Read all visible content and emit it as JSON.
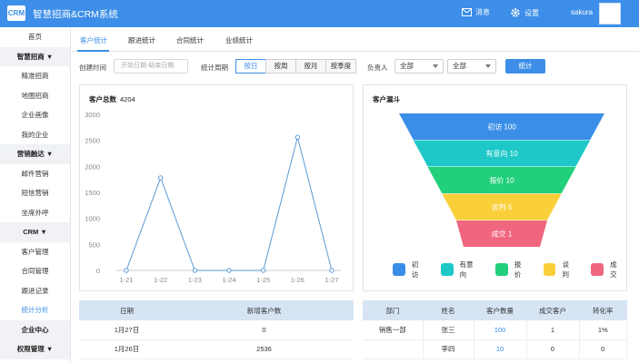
{
  "app": {
    "logo": "CRM",
    "title": "智慧招商&CRM系统"
  },
  "header": {
    "messages": "消息",
    "settings": "设置",
    "user": "sakura"
  },
  "sidebar": {
    "items": [
      {
        "label": "首页",
        "type": "item"
      },
      {
        "label": "智慧招商 ▼",
        "type": "group"
      },
      {
        "label": "精准招商",
        "type": "item"
      },
      {
        "label": "地图招商",
        "type": "item"
      },
      {
        "label": "企业画像",
        "type": "item"
      },
      {
        "label": "我的企业",
        "type": "item"
      },
      {
        "label": "营销触达 ▼",
        "type": "group"
      },
      {
        "label": "邮件营销",
        "type": "item"
      },
      {
        "label": "短信营销",
        "type": "item"
      },
      {
        "label": "坐席外呼",
        "type": "item"
      },
      {
        "label": "CRM ▼",
        "type": "group"
      },
      {
        "label": "客户管理",
        "type": "item"
      },
      {
        "label": "合同管理",
        "type": "item"
      },
      {
        "label": "跟进记录",
        "type": "item"
      },
      {
        "label": "统计分析",
        "type": "active"
      },
      {
        "label": "企业中心",
        "type": "group"
      },
      {
        "label": "权限管理 ▼",
        "type": "group"
      }
    ]
  },
  "tabs": [
    "客户统计",
    "跟进统计",
    "合同统计",
    "业绩统计"
  ],
  "filters": {
    "created_label": "创建时间",
    "date_placeholder": "开始日期-结束日期",
    "period_label": "统计周期",
    "periods": [
      "按日",
      "按周",
      "按月",
      "按季度"
    ],
    "owner_label": "负责人",
    "select1": "全部",
    "select2": "全部",
    "button": "统计"
  },
  "line_card": {
    "title": "客户总数",
    "total": "4204"
  },
  "chart_data": [
    {
      "type": "line",
      "title": "客户总数",
      "x": [
        "1-21",
        "1-22",
        "1-23",
        "1-24",
        "1-25",
        "1-26",
        "1-27"
      ],
      "values": [
        0,
        1780,
        0,
        0,
        0,
        2560,
        0
      ],
      "ylim": [
        0,
        3000
      ],
      "yticks": [
        0,
        500,
        1000,
        1500,
        2000,
        2500,
        3000
      ],
      "grid": false,
      "color": "#5b9bd5"
    },
    {
      "type": "funnel",
      "title": "客户漏斗",
      "categories": [
        "初访",
        "有意向",
        "报价",
        "谈判",
        "成交"
      ],
      "values": [
        100,
        10,
        10,
        5,
        1
      ],
      "colors": [
        "#3a8ee8",
        "#1ec8c8",
        "#22cf7a",
        "#f9cf3a",
        "#f0667f"
      ],
      "legend_position": "bottom"
    }
  ],
  "funnel_card": {
    "title": "客户漏斗"
  },
  "table1": {
    "headers": [
      "日期",
      "新增客户数"
    ],
    "rows": [
      [
        "1月27日",
        "0"
      ],
      [
        "1月26日",
        "2536"
      ]
    ]
  },
  "table2": {
    "headers": [
      "部门",
      "姓名",
      "客户数量",
      "成交客户",
      "转化率"
    ],
    "rows": [
      [
        "销售一部",
        "张三",
        "100",
        "1",
        "1%"
      ],
      [
        "",
        "李四",
        "10",
        "0",
        "0"
      ]
    ]
  }
}
